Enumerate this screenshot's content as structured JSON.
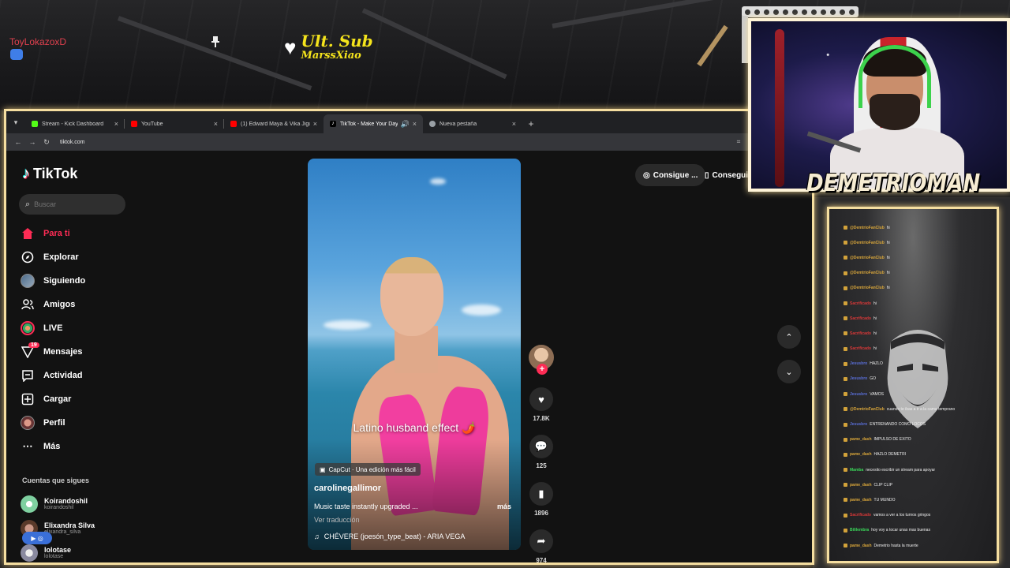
{
  "overlay": {
    "viewer_name": "ToyLokazoxD",
    "sub_title": "Ult. Sub",
    "sub_name": "MarssXiao",
    "streamer_name": "DEMETRIOMAN"
  },
  "browser": {
    "tabs": [
      {
        "label": "Stream - Kick Dashboard",
        "color": "#53fc18",
        "active": false
      },
      {
        "label": "YouTube",
        "color": "#ff0000",
        "active": false
      },
      {
        "label": "(1) Edward Maya & Vika Jigulina",
        "color": "#ff0000",
        "active": false
      },
      {
        "label": "TikTok - Make Your Day",
        "color": "#ffffff",
        "active": true
      },
      {
        "label": "Nueva pestaña",
        "color": "#9aa0a6",
        "active": false
      }
    ],
    "url": "tiktok.com"
  },
  "tiktok": {
    "logo_text": "TikTok",
    "search_placeholder": "Buscar",
    "nav": [
      {
        "label": "Para ti",
        "icon": "home-icon"
      },
      {
        "label": "Explorar",
        "icon": "compass-icon"
      },
      {
        "label": "Siguiendo",
        "icon": "following-avatar"
      },
      {
        "label": "Amigos",
        "icon": "friends-icon"
      },
      {
        "label": "LIVE",
        "icon": "live-avatar"
      },
      {
        "label": "Mensajes",
        "icon": "messages-icon",
        "badge": "19"
      },
      {
        "label": "Actividad",
        "icon": "activity-icon"
      },
      {
        "label": "Cargar",
        "icon": "upload-icon"
      },
      {
        "label": "Perfil",
        "icon": "profile-avatar"
      },
      {
        "label": "Más",
        "icon": "more-icon"
      }
    ],
    "following_title": "Cuentas que sigues",
    "accounts": [
      {
        "name": "Koirandoshil",
        "handle": "koirandoshil",
        "color": "#7fd0a0"
      },
      {
        "name": "Elixandra Silva",
        "handle": "elixandra_silva",
        "color": "#8a6a5a"
      },
      {
        "name": "lolotase",
        "handle": "lolotase",
        "color": "#a0a0b0"
      }
    ],
    "promo_1": "Consigue ...",
    "promo_2": "Consegui",
    "video": {
      "caption": "Latino husband effect 🌶️",
      "capcut": "CapCut · Una edición más fácil",
      "author": "carolinegallimor",
      "description": "Music taste instantly upgraded ...",
      "more": "más",
      "translate": "Ver traducción",
      "music": "CHÉVERE (joesón_type_beat) - ARIA VEGA"
    },
    "actions": {
      "likes": "17.8K",
      "comments": "125",
      "saves": "1896",
      "shares": "974"
    }
  },
  "chat": [
    {
      "user": "@DemtrioFanClub",
      "text": "hi",
      "color": "#d9a63a"
    },
    {
      "user": "@DemtrioFanClub",
      "text": "hi",
      "color": "#d9a63a"
    },
    {
      "user": "@DemtrioFanClub",
      "text": "hi",
      "color": "#d9a63a"
    },
    {
      "user": "@DemtrioFanClub",
      "text": "hi",
      "color": "#d9a63a"
    },
    {
      "user": "@DemtrioFanClub",
      "text": "hi",
      "color": "#d9a63a"
    },
    {
      "user": "Sacrificado",
      "text": "hi",
      "color": "#d93838"
    },
    {
      "user": "Sacrificado",
      "text": "hi",
      "color": "#d93838"
    },
    {
      "user": "Sacrificado",
      "text": "hi",
      "color": "#d93838"
    },
    {
      "user": "Sacrificado",
      "text": "hi",
      "color": "#d93838"
    },
    {
      "user": "Jesusbro",
      "text": "HAZLO",
      "color": "#5a6fd8"
    },
    {
      "user": "Jesusbro",
      "text": "GO",
      "color": "#5a6fd8"
    },
    {
      "user": "Jesusbro",
      "text": "VAMOS",
      "color": "#5a6fd8"
    },
    {
      "user": "@DemtrioFanClub",
      "text": "cuando te ibas a ir a la cama temprano",
      "color": "#d9a63a"
    },
    {
      "user": "Jesusbro",
      "text": "ENTRENANDO COMO LOCOS",
      "color": "#5a6fd8"
    },
    {
      "user": "pame_dash",
      "text": "IMPULSO DE EXITO",
      "color": "#d9a63a"
    },
    {
      "user": "pame_dash",
      "text": "HAZLO DEMETRI",
      "color": "#d9a63a"
    },
    {
      "user": "Mamba",
      "text": "necesito escribir un stream para apoyar",
      "color": "#3ad95a"
    },
    {
      "user": "pame_dash",
      "text": "CLIP CLIP",
      "color": "#d9a63a"
    },
    {
      "user": "pame_dash",
      "text": "TU MUNDO",
      "color": "#d9a63a"
    },
    {
      "user": "Sacrificado",
      "text": "vamos a ver a los turnos gringos",
      "color": "#d93838"
    },
    {
      "user": "Bililembra",
      "text": "hoy voy a tocar unas mas buenas",
      "color": "#3ad95a"
    },
    {
      "user": "pame_dash",
      "text": "Demetrio hasta la muerte",
      "color": "#d9a63a"
    }
  ]
}
